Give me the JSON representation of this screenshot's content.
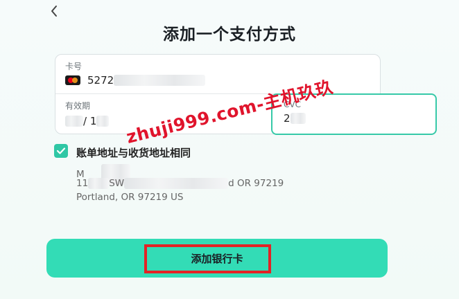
{
  "header": {
    "title": "添加一个支付方式"
  },
  "card": {
    "number_label": "卡号",
    "number_value": "5272",
    "expiry_label": "有效期",
    "expiry_value": "/ 1",
    "cvc_label": "CVC",
    "cvc_value": "2"
  },
  "billing": {
    "same_address_label": "账单地址与收货地址相同",
    "checked": true,
    "address_line1": "M",
    "address_line2_start": "11",
    "address_line2_mid": "SW",
    "address_line2_end": "d OR 97219",
    "address_line3": "Portland, OR 97219 US"
  },
  "watermark": "zhuji999.com-主机玖玖",
  "submit": {
    "label": "添加银行卡"
  },
  "colors": {
    "accent": "#33dcb6",
    "checkbox": "#2fc7a5",
    "highlight": "#e32225",
    "watermark": "#e0142c"
  }
}
